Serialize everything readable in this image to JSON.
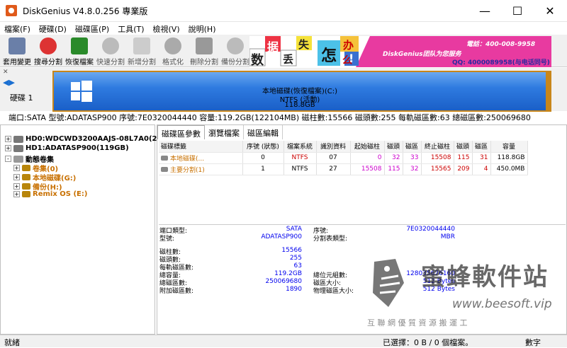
{
  "window": {
    "title": "DiskGenius V4.8.0.256 專業版"
  },
  "menu": [
    "檔案(F)",
    "硬碟(D)",
    "磁碟區(P)",
    "工具(T)",
    "檢視(V)",
    "說明(H)"
  ],
  "toolbar": [
    "套用變更",
    "搜尋分割",
    "恢復檔案",
    "快速分割",
    "新增分割",
    "格式化",
    "刪除分割",
    "備份分割"
  ],
  "banner": {
    "chars": [
      "数",
      "据",
      "丢",
      "失",
      "怎",
      "么",
      "办",
      "!"
    ],
    "brand": "DiskGenius团队为您服务",
    "tel": "電話：400-008-9958",
    "qq": "QQ: 4000089958(与电话同号)"
  },
  "disk_label": "硬碟 1",
  "partition_bar": {
    "name": "本地磁碟(恢復檔案)(C:)",
    "fs": "NTFS (活動)",
    "size": "118.8GB"
  },
  "disk_info": "端口:SATA  型號:ADATASP900  序號:7E0320044440  容量:119.2GB(122104MB)  磁柱數:15566  磁頭數:255  每軌磁區數:63  總磁區數:250069680",
  "tree": [
    {
      "label": "HD0:WDCWD3200AAJS-08L7A0(298G)",
      "kind": "disk"
    },
    {
      "label": "HD1:ADATASP900(119GB)",
      "kind": "disk"
    },
    {
      "label": "動態卷集",
      "kind": "group"
    },
    {
      "label": "卷集(0)",
      "kind": "part"
    },
    {
      "label": "本地磁碟(G:)",
      "kind": "part"
    },
    {
      "label": "備份(H:)",
      "kind": "part"
    },
    {
      "label": "Remix OS (E:)",
      "kind": "part"
    }
  ],
  "tabs": [
    "磁碟區參數",
    "瀏覽檔案",
    "磁區編輯"
  ],
  "table": {
    "headers": [
      "磁碟標籤",
      "序號 (狀態)",
      "檔案系統",
      "識別資料",
      "起始磁柱",
      "磁頭",
      "磁區",
      "終止磁柱",
      "磁頭",
      "磁區",
      "容量"
    ],
    "rows": [
      [
        "本地磁碟(...",
        "0",
        "NTFS",
        "07",
        "0",
        "32",
        "33",
        "15508",
        "115",
        "31",
        "118.8GB"
      ],
      [
        "主要分割(1)",
        "1",
        "NTFS",
        "27",
        "15508",
        "115",
        "32",
        "15565",
        "209",
        "4",
        "450.0MB"
      ]
    ]
  },
  "details": {
    "port_type_label": "端口類型:",
    "port_type": "SATA",
    "serial_label": "序號:",
    "serial": "7E0320044440",
    "model_label": "型號:",
    "model": "ADATASP900",
    "parttable_label": "分割表類型:",
    "parttable": "MBR",
    "cyl_label": "磁柱數:",
    "cyl": "15566",
    "heads_label": "磁頭數:",
    "heads": "255",
    "spt_label": "每軌磁區數:",
    "spt": "63",
    "cap_label": "總容量:",
    "cap": "119.2GB",
    "bytes_label": "總位元組數:",
    "bytes": "128035676160",
    "sectors_label": "總磁區數:",
    "sectors": "250069680",
    "secsize_label": "磁區大小:",
    "secsize": "512 Bytes",
    "extra_label": "附加磁區數:",
    "extra": "1890",
    "physsec_label": "物理磁區大小:",
    "physsec": "512 Bytes"
  },
  "watermark": {
    "name": "蜜蜂軟件站",
    "url": "www.beesoft.vip",
    "slogan": "互 聯 網 優 質 資 源 搬 運 工"
  },
  "status": {
    "left": "就緒",
    "selected": "已選擇：0 B / 0 個檔案。",
    "mode": "數字"
  }
}
